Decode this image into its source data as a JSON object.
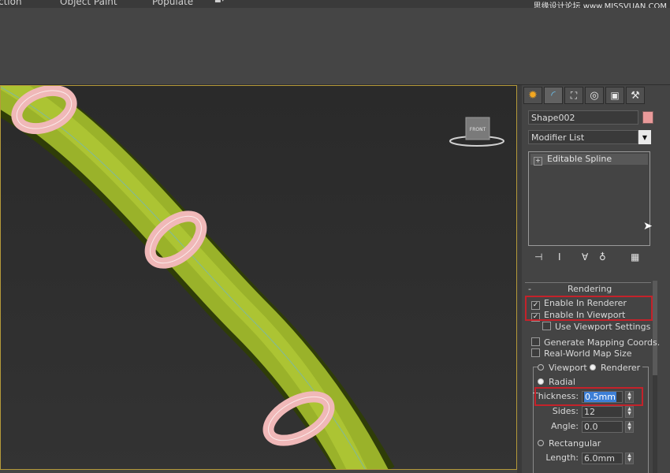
{
  "menu": {
    "items": [
      "ction",
      "Object Paint",
      "Populate"
    ],
    "watermark": "思缘设计论坛 www.MISSVUAN.COM"
  },
  "viewport": {
    "viewcube_label": "FRONT"
  },
  "command_panel": {
    "tabs": [
      "create-icon",
      "modify-icon",
      "hierarchy-icon",
      "motion-icon",
      "display-icon",
      "utilities-icon"
    ],
    "object_name": "Shape002",
    "object_color": "#e99a9a",
    "modifier_list": "Modifier List",
    "stack_item": "Editable Spline",
    "rendering": {
      "rollout_toggle": "-",
      "title": "Rendering",
      "enable_in_renderer": "Enable In Renderer",
      "enable_in_renderer_checked": true,
      "enable_in_viewport": "Enable In Viewport",
      "enable_in_viewport_checked": true,
      "use_viewport_settings": "Use Viewport Settings",
      "generate_mapping": "Generate Mapping Coords.",
      "real_world_map": "Real-World Map Size",
      "viewport_radio": "Viewport",
      "renderer_radio": "Renderer",
      "radial": "Radial",
      "thickness_label": "Thickness:",
      "thickness_value": "0.5mm",
      "sides_label": "Sides:",
      "sides_value": "12",
      "angle_label": "Angle:",
      "angle_value": "0.0",
      "rectangular": "Rectangular",
      "length_label": "Length:",
      "length_value": "6.0mm"
    }
  },
  "colors": {
    "highlight_box": "#c4222a",
    "tube": "#a9c230",
    "rings": "#f0b8b8",
    "viewport_border": "#b59a3a"
  }
}
